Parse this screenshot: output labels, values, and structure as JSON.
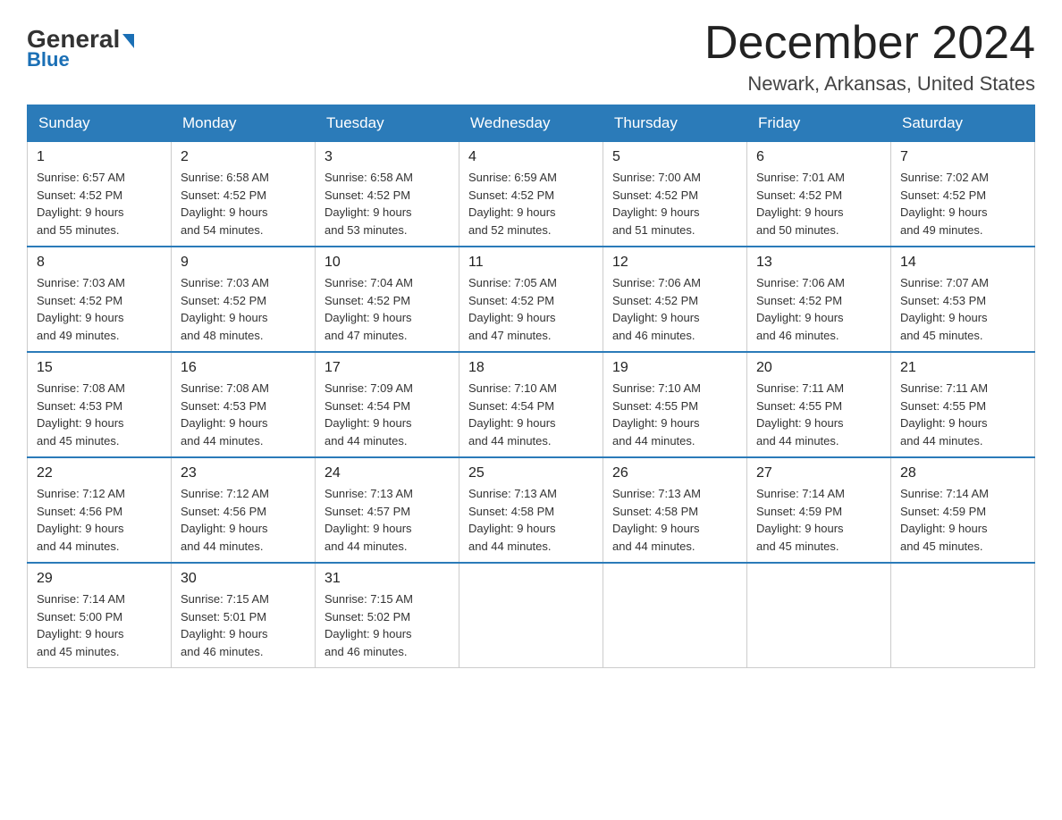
{
  "logo": {
    "text_general": "General",
    "arrow": "▶",
    "text_blue": "Blue"
  },
  "header": {
    "month_title": "December 2024",
    "location": "Newark, Arkansas, United States"
  },
  "weekdays": [
    "Sunday",
    "Monday",
    "Tuesday",
    "Wednesday",
    "Thursday",
    "Friday",
    "Saturday"
  ],
  "weeks": [
    [
      {
        "day": "1",
        "sunrise": "6:57 AM",
        "sunset": "4:52 PM",
        "daylight": "9 hours and 55 minutes."
      },
      {
        "day": "2",
        "sunrise": "6:58 AM",
        "sunset": "4:52 PM",
        "daylight": "9 hours and 54 minutes."
      },
      {
        "day": "3",
        "sunrise": "6:58 AM",
        "sunset": "4:52 PM",
        "daylight": "9 hours and 53 minutes."
      },
      {
        "day": "4",
        "sunrise": "6:59 AM",
        "sunset": "4:52 PM",
        "daylight": "9 hours and 52 minutes."
      },
      {
        "day": "5",
        "sunrise": "7:00 AM",
        "sunset": "4:52 PM",
        "daylight": "9 hours and 51 minutes."
      },
      {
        "day": "6",
        "sunrise": "7:01 AM",
        "sunset": "4:52 PM",
        "daylight": "9 hours and 50 minutes."
      },
      {
        "day": "7",
        "sunrise": "7:02 AM",
        "sunset": "4:52 PM",
        "daylight": "9 hours and 49 minutes."
      }
    ],
    [
      {
        "day": "8",
        "sunrise": "7:03 AM",
        "sunset": "4:52 PM",
        "daylight": "9 hours and 49 minutes."
      },
      {
        "day": "9",
        "sunrise": "7:03 AM",
        "sunset": "4:52 PM",
        "daylight": "9 hours and 48 minutes."
      },
      {
        "day": "10",
        "sunrise": "7:04 AM",
        "sunset": "4:52 PM",
        "daylight": "9 hours and 47 minutes."
      },
      {
        "day": "11",
        "sunrise": "7:05 AM",
        "sunset": "4:52 PM",
        "daylight": "9 hours and 47 minutes."
      },
      {
        "day": "12",
        "sunrise": "7:06 AM",
        "sunset": "4:52 PM",
        "daylight": "9 hours and 46 minutes."
      },
      {
        "day": "13",
        "sunrise": "7:06 AM",
        "sunset": "4:52 PM",
        "daylight": "9 hours and 46 minutes."
      },
      {
        "day": "14",
        "sunrise": "7:07 AM",
        "sunset": "4:53 PM",
        "daylight": "9 hours and 45 minutes."
      }
    ],
    [
      {
        "day": "15",
        "sunrise": "7:08 AM",
        "sunset": "4:53 PM",
        "daylight": "9 hours and 45 minutes."
      },
      {
        "day": "16",
        "sunrise": "7:08 AM",
        "sunset": "4:53 PM",
        "daylight": "9 hours and 44 minutes."
      },
      {
        "day": "17",
        "sunrise": "7:09 AM",
        "sunset": "4:54 PM",
        "daylight": "9 hours and 44 minutes."
      },
      {
        "day": "18",
        "sunrise": "7:10 AM",
        "sunset": "4:54 PM",
        "daylight": "9 hours and 44 minutes."
      },
      {
        "day": "19",
        "sunrise": "7:10 AM",
        "sunset": "4:55 PM",
        "daylight": "9 hours and 44 minutes."
      },
      {
        "day": "20",
        "sunrise": "7:11 AM",
        "sunset": "4:55 PM",
        "daylight": "9 hours and 44 minutes."
      },
      {
        "day": "21",
        "sunrise": "7:11 AM",
        "sunset": "4:55 PM",
        "daylight": "9 hours and 44 minutes."
      }
    ],
    [
      {
        "day": "22",
        "sunrise": "7:12 AM",
        "sunset": "4:56 PM",
        "daylight": "9 hours and 44 minutes."
      },
      {
        "day": "23",
        "sunrise": "7:12 AM",
        "sunset": "4:56 PM",
        "daylight": "9 hours and 44 minutes."
      },
      {
        "day": "24",
        "sunrise": "7:13 AM",
        "sunset": "4:57 PM",
        "daylight": "9 hours and 44 minutes."
      },
      {
        "day": "25",
        "sunrise": "7:13 AM",
        "sunset": "4:58 PM",
        "daylight": "9 hours and 44 minutes."
      },
      {
        "day": "26",
        "sunrise": "7:13 AM",
        "sunset": "4:58 PM",
        "daylight": "9 hours and 44 minutes."
      },
      {
        "day": "27",
        "sunrise": "7:14 AM",
        "sunset": "4:59 PM",
        "daylight": "9 hours and 45 minutes."
      },
      {
        "day": "28",
        "sunrise": "7:14 AM",
        "sunset": "4:59 PM",
        "daylight": "9 hours and 45 minutes."
      }
    ],
    [
      {
        "day": "29",
        "sunrise": "7:14 AM",
        "sunset": "5:00 PM",
        "daylight": "9 hours and 45 minutes."
      },
      {
        "day": "30",
        "sunrise": "7:15 AM",
        "sunset": "5:01 PM",
        "daylight": "9 hours and 46 minutes."
      },
      {
        "day": "31",
        "sunrise": "7:15 AM",
        "sunset": "5:02 PM",
        "daylight": "9 hours and 46 minutes."
      },
      null,
      null,
      null,
      null
    ]
  ],
  "labels": {
    "sunrise": "Sunrise:",
    "sunset": "Sunset:",
    "daylight": "Daylight:"
  }
}
